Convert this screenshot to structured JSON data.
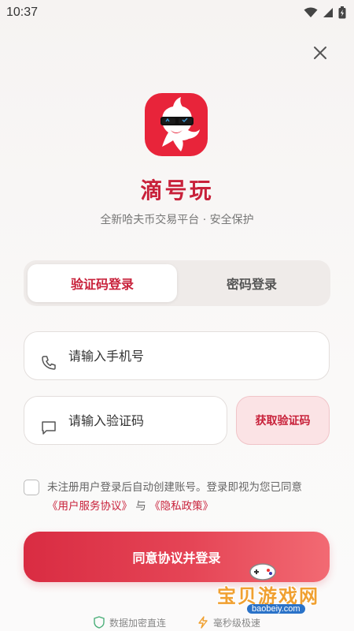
{
  "status_bar": {
    "time": "10:37"
  },
  "app": {
    "name": "滴号玩",
    "subtitle": "全新哈夫币交易平台 · 安全保护"
  },
  "tabs": [
    {
      "label": "验证码登录",
      "active": true
    },
    {
      "label": "密码登录",
      "active": false
    }
  ],
  "form": {
    "phone_placeholder": "请输入手机号",
    "code_placeholder": "请输入验证码",
    "get_code_label": "获取验证码"
  },
  "agreement": {
    "text": "未注册用户登录后自动创建账号。登录即视为您已同意",
    "user_agreement": "《用户服务协议》",
    "and": "与",
    "privacy_policy": "《隐私政策》"
  },
  "login_button": {
    "label": "同意协议并登录"
  },
  "footer": {
    "item1": "数据加密直连",
    "item2": "毫秒级极速"
  },
  "watermark": {
    "text": "宝贝游戏网",
    "url": "baobeiy.com"
  },
  "colors": {
    "brand": "#c8213a",
    "logo_bg": "#e8243a"
  }
}
